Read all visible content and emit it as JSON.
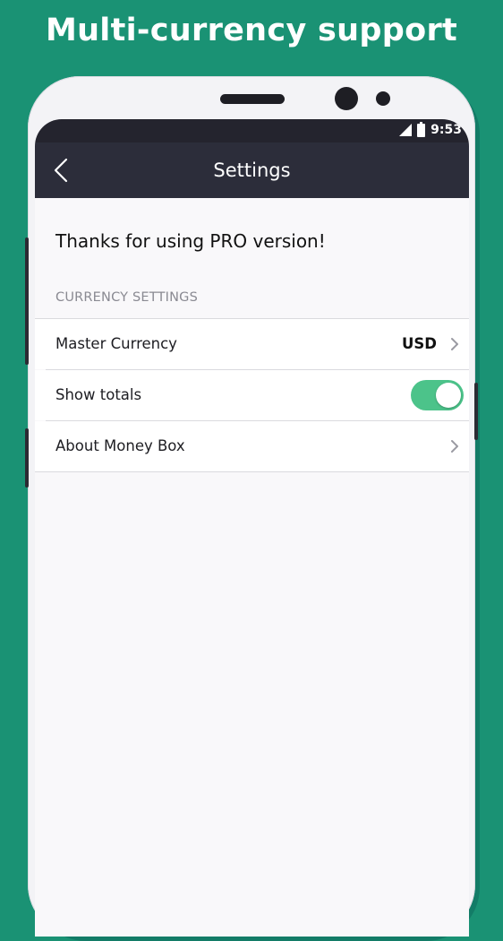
{
  "banner": {
    "title": "Multi-currency support"
  },
  "status_bar": {
    "time": "9:53"
  },
  "app_bar": {
    "title": "Settings",
    "back_icon": "chevron-left-icon"
  },
  "pro_message": "Thanks for using PRO version!",
  "sections": {
    "currency_settings": {
      "header": "CURRENCY SETTINGS",
      "master_currency": {
        "label": "Master Currency",
        "value": "USD"
      },
      "show_totals": {
        "label": "Show totals",
        "enabled": true
      },
      "about": {
        "label": "About Money Box"
      }
    }
  },
  "colors": {
    "background": "#1a9274",
    "app_bar": "#2c2d3a",
    "toggle_on": "#4cc38a"
  }
}
